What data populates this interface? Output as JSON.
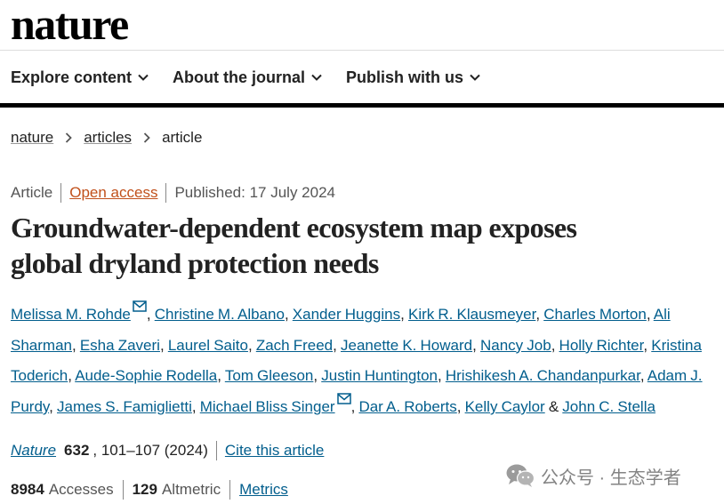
{
  "header": {
    "logo": "nature",
    "nav": [
      {
        "label": "Explore content"
      },
      {
        "label": "About the journal"
      },
      {
        "label": "Publish with us"
      }
    ]
  },
  "breadcrumb": {
    "items": [
      "nature",
      "articles"
    ],
    "current": "article"
  },
  "article": {
    "type": "Article",
    "access": "Open access",
    "published": "Published: 17 July 2024",
    "title_line1": "Groundwater-dependent ecosystem map exposes",
    "title_line2": "global dryland protection needs",
    "authors": [
      "Melissa M. Rohde",
      "Christine M. Albano",
      "Xander Huggins",
      "Kirk R. Klausmeyer",
      "Charles Morton",
      "Ali Sharman",
      "Esha Zaveri",
      "Laurel Saito",
      "Zach Freed",
      "Jeanette K. Howard",
      "Nancy Job",
      "Holly Richter",
      "Kristina Toderich",
      "Aude-Sophie Rodella",
      "Tom Gleeson",
      "Justin Huntington",
      "Hrishikesh A. Chandanpurkar",
      "Adam J. Purdy",
      "James S. Famiglietti",
      "Michael Bliss Singer",
      "Dar A. Roberts",
      "Kelly Caylor",
      "John C. Stella"
    ],
    "last_separator": "&",
    "citation": {
      "journal": "Nature",
      "volume": "632",
      "pages": ", 101–107 (2024)",
      "cite_label": "Cite this article"
    },
    "metrics": {
      "accesses_value": "8984",
      "accesses_label": "Accesses",
      "altmetric_value": "129",
      "altmetric_label": "Altmetric",
      "metrics_link": "Metrics"
    }
  },
  "watermark": "公众号 · 生态学者",
  "colors": {
    "link": "#025e8d",
    "open_access": "#c1501b",
    "text": "#222222",
    "muted": "#555555"
  }
}
